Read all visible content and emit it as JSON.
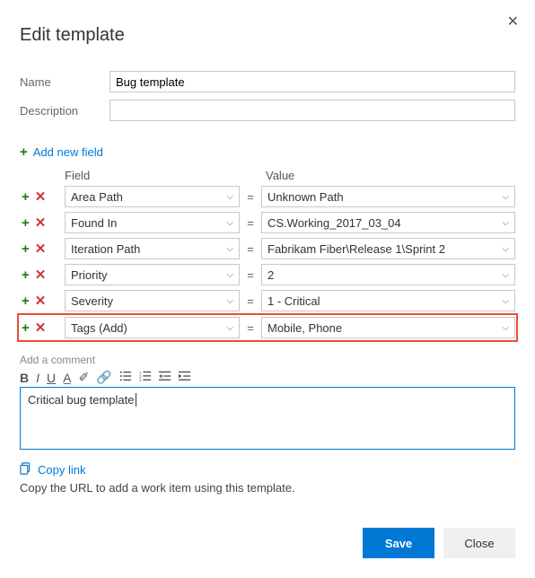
{
  "dialog": {
    "title": "Edit template",
    "name_label": "Name",
    "name_value": "Bug template",
    "description_label": "Description",
    "description_value": ""
  },
  "add_new_label": "Add new field",
  "headers": {
    "field": "Field",
    "value": "Value"
  },
  "rows": [
    {
      "field": "Area Path",
      "value": "Unknown Path",
      "highlight": false
    },
    {
      "field": "Found In",
      "value": "CS.Working_2017_03_04",
      "highlight": false
    },
    {
      "field": "Iteration Path",
      "value": "Fabrikam Fiber\\Release 1\\Sprint 2",
      "highlight": false
    },
    {
      "field": "Priority",
      "value": "2",
      "highlight": false
    },
    {
      "field": "Severity",
      "value": "1 - Critical",
      "highlight": false
    },
    {
      "field": "Tags (Add)",
      "value": "Mobile, Phone",
      "highlight": true
    }
  ],
  "comment": {
    "label": "Add a comment",
    "text": "Critical bug template"
  },
  "copy": {
    "link_label": "Copy link",
    "hint": "Copy the URL to add a work item using this template."
  },
  "buttons": {
    "save": "Save",
    "close": "Close"
  }
}
